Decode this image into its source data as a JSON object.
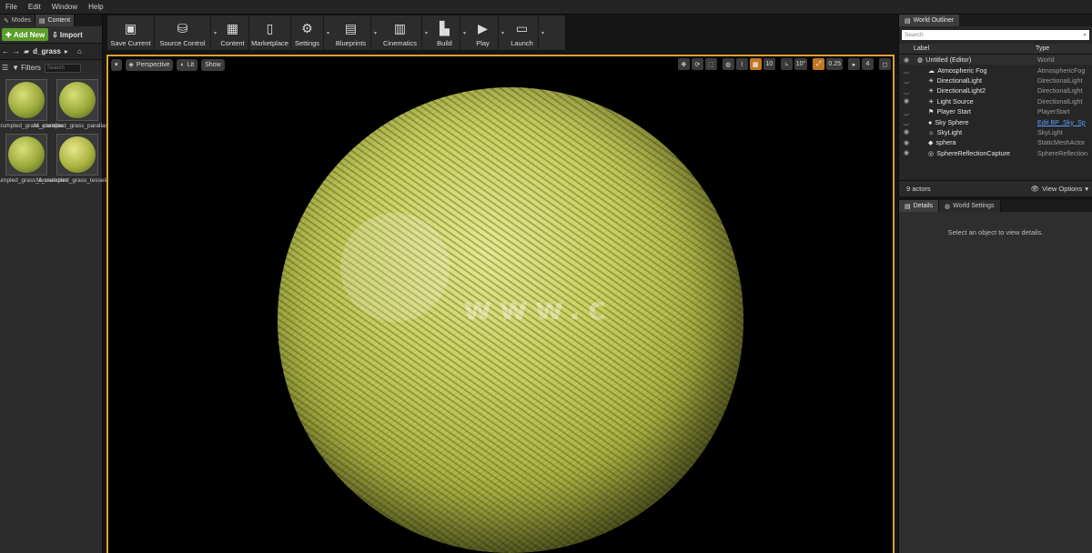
{
  "menu": [
    "File",
    "Edit",
    "Window",
    "Help"
  ],
  "left_tabs": [
    {
      "label": "Modes",
      "icon": "modes-icon"
    },
    {
      "label": "Content",
      "icon": "content-icon"
    }
  ],
  "content_browser": {
    "add_new": "Add New",
    "import": "Import",
    "path": "d_grass",
    "filters": "Filters",
    "search_placeholder": "Search",
    "assets": [
      {
        "name": "M_crumpled_grass_parallax"
      },
      {
        "name": "M_crumpled_grass_parallax_Inst"
      },
      {
        "name": "M_crumpled_grass_tesselation"
      },
      {
        "name": "M_crumpled_grass_tesselation"
      }
    ]
  },
  "toolbar": [
    {
      "label": "Save Current",
      "icon": "save-icon",
      "dropdown": false
    },
    {
      "label": "Source Control",
      "icon": "source-control-icon",
      "dropdown": true
    },
    {
      "label": "Content",
      "icon": "content-browser-icon",
      "dropdown": false
    },
    {
      "label": "Marketplace",
      "icon": "marketplace-icon",
      "dropdown": false
    },
    {
      "label": "Settings",
      "icon": "settings-icon",
      "dropdown": true
    },
    {
      "label": "Blueprints",
      "icon": "blueprints-icon",
      "dropdown": true
    },
    {
      "label": "Cinematics",
      "icon": "cinematics-icon",
      "dropdown": true
    },
    {
      "label": "Build",
      "icon": "build-icon",
      "dropdown": true
    },
    {
      "label": "Play",
      "icon": "play-icon",
      "dropdown": true
    },
    {
      "label": "Launch",
      "icon": "launch-icon",
      "dropdown": true
    }
  ],
  "viewport": {
    "perspective": "Perspective",
    "lit": "Lit",
    "show": "Show",
    "grid_snap": "10",
    "rot_snap": "10°",
    "scale_snap": "0.25",
    "camera_speed": "4",
    "watermark_url": "www.c"
  },
  "outliner": {
    "tab": "World Outliner",
    "search_placeholder": "Search",
    "col_label": "Label",
    "col_type": "Type",
    "rows": [
      {
        "label": "Untitled (Editor)",
        "type": "World",
        "visible": true,
        "icon": "world-icon",
        "link": false
      },
      {
        "label": "Atmospheric Fog",
        "type": "AtmosphericFog",
        "visible": false,
        "icon": "fog-icon",
        "link": false
      },
      {
        "label": "DirectionalLight",
        "type": "DirectionalLight",
        "visible": false,
        "icon": "light-icon",
        "link": false
      },
      {
        "label": "DirectionalLight2",
        "type": "DirectionalLight",
        "visible": false,
        "icon": "light-icon",
        "link": false
      },
      {
        "label": "Light Source",
        "type": "DirectionalLight",
        "visible": true,
        "icon": "light-icon",
        "link": false
      },
      {
        "label": "Player Start",
        "type": "PlayerStart",
        "visible": false,
        "icon": "player-start-icon",
        "link": false
      },
      {
        "label": "Sky Sphere",
        "type": "Edit BP_Sky_Sp",
        "visible": false,
        "icon": "sphere-icon",
        "link": true
      },
      {
        "label": "SkyLight",
        "type": "SkyLight",
        "visible": true,
        "icon": "skylight-icon",
        "link": false
      },
      {
        "label": "sphera",
        "type": "StaticMeshActor",
        "visible": true,
        "icon": "mesh-icon",
        "link": false
      },
      {
        "label": "SphereReflectionCapture",
        "type": "SphereReflection",
        "visible": true,
        "icon": "reflection-icon",
        "link": false
      }
    ],
    "actor_count": "9 actors",
    "view_options": "View Options"
  },
  "details": {
    "tab_details": "Details",
    "tab_world": "World Settings",
    "empty": "Select an object to view details."
  }
}
